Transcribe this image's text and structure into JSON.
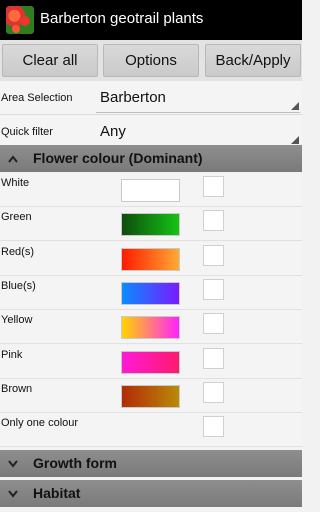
{
  "titlebar": {
    "title": "Barberton geotrail plants",
    "icon": "plant-photo-icon"
  },
  "buttons": {
    "clear_all": "Clear all",
    "options": "Options",
    "back_apply": "Back/Apply"
  },
  "area": {
    "label": "Area Selection",
    "value": "Barberton"
  },
  "quick_filter": {
    "label": "Quick filter",
    "value": "Any"
  },
  "flower_colour": {
    "title": "Flower colour (Dominant)",
    "rows": [
      {
        "label": "White",
        "swatch": [
          "#ffffff",
          "#ffffff"
        ],
        "checked": false
      },
      {
        "label": "Green",
        "swatch": [
          "#0e4d0e",
          "#14c414"
        ],
        "checked": false
      },
      {
        "label": "Red(s)",
        "swatch": [
          "#ff1a00",
          "#ffaa33"
        ],
        "checked": false
      },
      {
        "label": "Blue(s)",
        "swatch": [
          "#0a8cff",
          "#7a1aff"
        ],
        "checked": false
      },
      {
        "label": "Yellow",
        "swatch": [
          "#ffd400",
          "#ff22ff"
        ],
        "checked": false
      },
      {
        "label": "Pink",
        "swatch": [
          "#ff1ad6",
          "#ff1a6e"
        ],
        "checked": false
      },
      {
        "label": "Brown",
        "swatch": [
          "#b22b08",
          "#b98a08"
        ],
        "checked": false
      },
      {
        "label": "Only one colour",
        "swatch": null,
        "checked": false
      }
    ]
  },
  "growth_form": {
    "title": "Growth form"
  },
  "habitat": {
    "title": "Habitat"
  },
  "colors": {
    "titlebar_bg": "#000000",
    "section_header_bg": "#838383",
    "page_bg": "#f2f2f2"
  }
}
